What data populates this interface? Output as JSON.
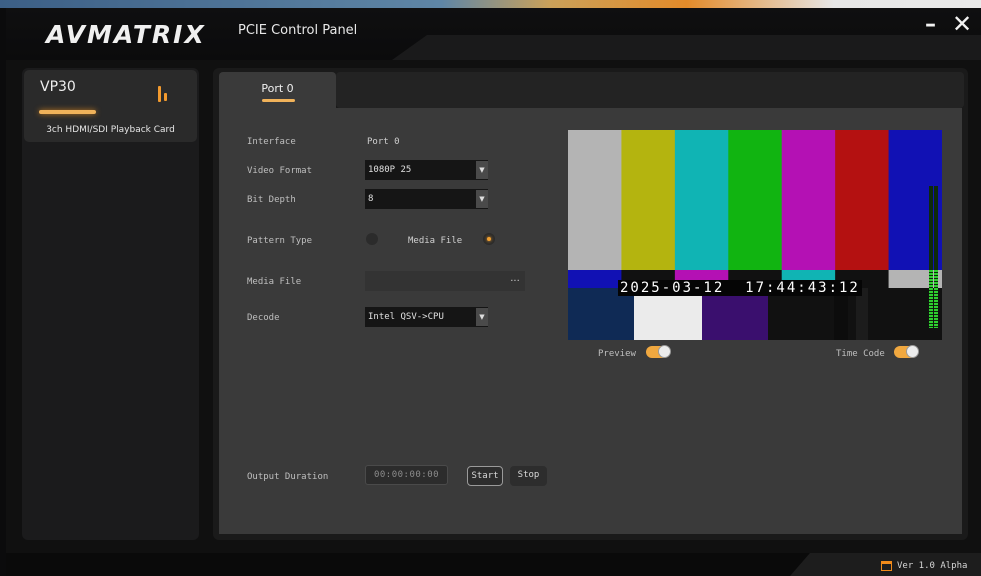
{
  "window": {
    "logo_text": "AVMATRIX",
    "title": "PCIE  Control Panel",
    "minimize_symbol": "–",
    "close_symbol": "✕"
  },
  "device_list": [
    {
      "name": "VP30",
      "description": "3ch HDMI/SDI Playback Card",
      "icon": "signal-bars-icon",
      "selected": true
    }
  ],
  "tabs": [
    {
      "label": "Port 0",
      "active": true
    }
  ],
  "form": {
    "interface": {
      "label": "Interface",
      "value": "Port 0"
    },
    "video_format": {
      "label": "Video Format",
      "value": "1080P 25"
    },
    "bit_depth": {
      "label": "Bit Depth",
      "value": "8"
    },
    "pattern_type": {
      "label": "Pattern Type",
      "options": [
        {
          "label": "",
          "selected": false
        },
        {
          "label": "Media File",
          "selected": true
        }
      ]
    },
    "media_file": {
      "label": "Media File",
      "value": "",
      "browse_label": "..."
    },
    "decode": {
      "label": "Decode",
      "value": "Intel QSV->CPU"
    },
    "output_duration": {
      "label": "Output Duration",
      "value": "00:00:00:00"
    }
  },
  "buttons": {
    "start": "Start",
    "stop": "Stop"
  },
  "preview": {
    "timecode": "2025-03-12  17:44:43:12",
    "preview_toggle": {
      "label": "Preview",
      "on": true
    },
    "timecode_toggle": {
      "label": "Time Code",
      "on": true
    },
    "color_bars_top": [
      "#b4b4b4",
      "#b4b40f",
      "#10b4b4",
      "#11b411",
      "#b411b4",
      "#b41111",
      "#1111b4"
    ],
    "color_bars_mid": [
      "#1111b4",
      "#111111",
      "#b411b4",
      "#111111",
      "#10b4b4",
      "#111111",
      "#b4b4b4"
    ],
    "color_bars_bottom": [
      "#0f2a55",
      "#ebebeb",
      "#3a0f6e",
      "#111111"
    ]
  },
  "footer": {
    "version": "Ver 1.0 Alpha"
  },
  "colors": {
    "accent": "#f0a030",
    "panel_bg": "#3a3a3a"
  }
}
